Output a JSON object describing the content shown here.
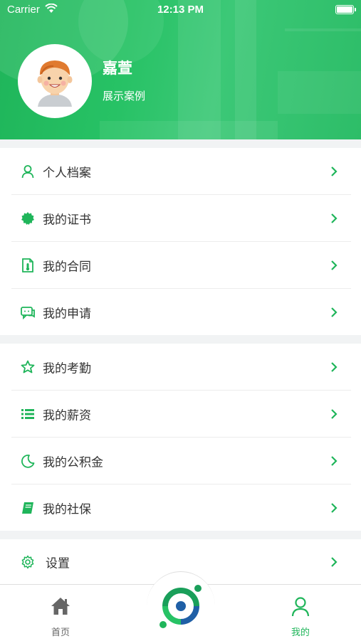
{
  "status_bar": {
    "carrier": "Carrier",
    "time": "12:13 PM"
  },
  "profile": {
    "name": "嘉萱",
    "subtitle": "展示案例",
    "avatar_icon": "cartoon-person-avatar"
  },
  "colors": {
    "brand_green": "#27c265",
    "icon_green": "#1fb55a",
    "tab_inactive": "#666666"
  },
  "section1": [
    {
      "label": "个人档案",
      "icon": "person-icon"
    },
    {
      "label": "我的证书",
      "icon": "certificate-badge-icon"
    },
    {
      "label": "我的合同",
      "icon": "contract-document-icon"
    },
    {
      "label": "我的申请",
      "icon": "chat-bubbles-icon"
    }
  ],
  "section2": [
    {
      "label": "我的考勤",
      "icon": "star-icon"
    },
    {
      "label": "我的薪资",
      "icon": "list-icon"
    },
    {
      "label": "我的公积金",
      "icon": "moon-icon"
    },
    {
      "label": "我的社保",
      "icon": "book-icon"
    }
  ],
  "section3": [
    {
      "label": "设置",
      "icon": "gear-icon"
    }
  ],
  "tabbar": {
    "home_label": "首页",
    "mine_label": "我的",
    "center_icon": "app-logo-icon",
    "active_tab": "mine"
  }
}
